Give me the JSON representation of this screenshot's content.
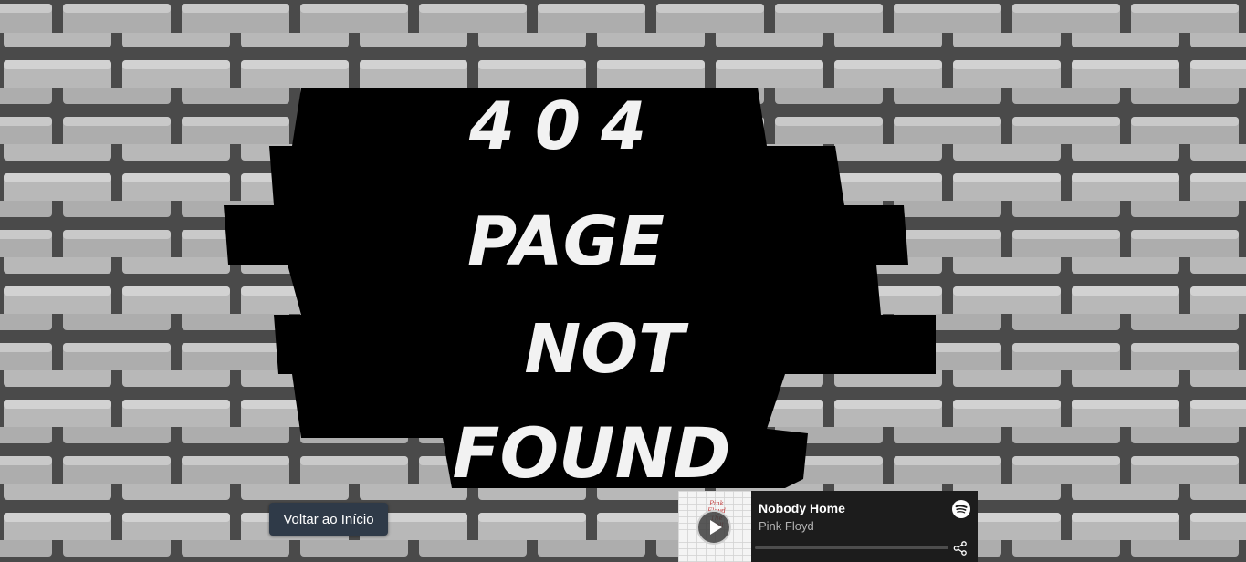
{
  "hole_text": {
    "line1": "404",
    "line2": "PAGE",
    "line3": "NOT",
    "line4": "FOUND"
  },
  "back_button": {
    "label": "Voltar ao Início"
  },
  "player": {
    "album_art_text": "Pink Floyd The Wall",
    "track_title": "Nobody Home",
    "artist": "Pink Floyd",
    "progress": 0,
    "play_icon": "play-icon",
    "brand_icon": "spotify-icon",
    "share_icon": "share-icon"
  },
  "colors": {
    "button_bg": "#2f3a48",
    "player_bg": "#1c1c1c",
    "spotify_logo": "#ffffff",
    "hole": "#000000"
  }
}
